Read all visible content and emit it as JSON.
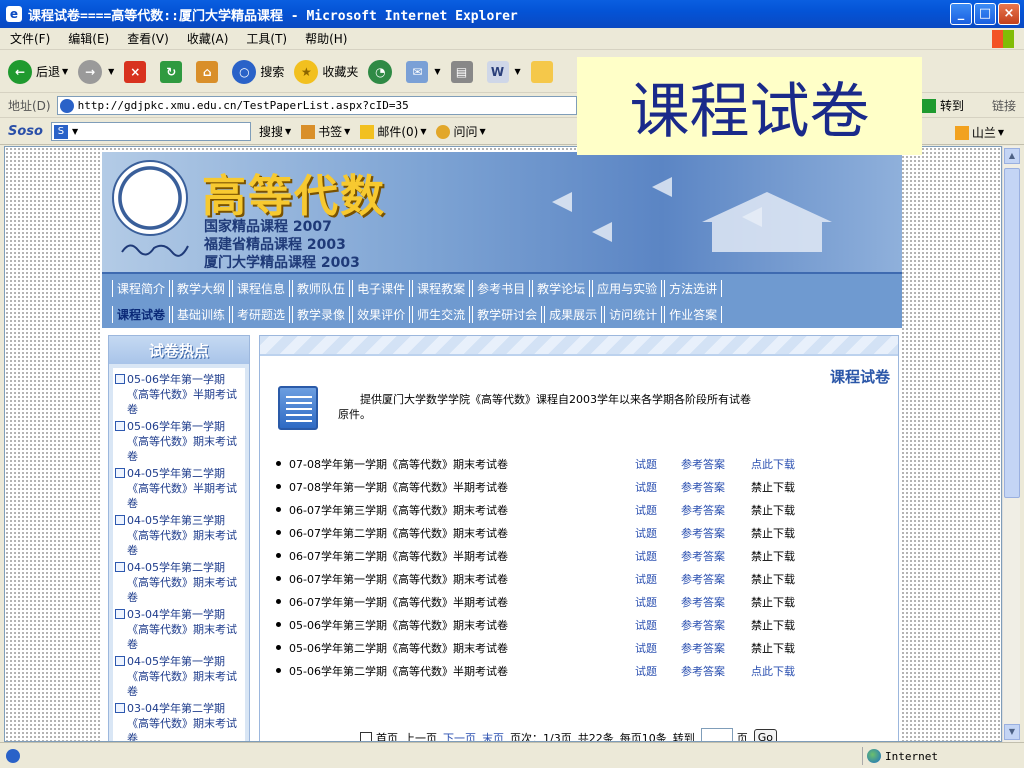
{
  "window": {
    "title": "课程试卷====高等代数::厦门大学精品课程 - Microsoft Internet Explorer",
    "minimize_icon": "minimize-icon",
    "maximize_icon": "maximize-icon",
    "close_icon": "close-icon"
  },
  "menubar": {
    "items": [
      "文件(F)",
      "编辑(E)",
      "查看(V)",
      "收藏(A)",
      "工具(T)",
      "帮助(H)"
    ]
  },
  "toolbar": {
    "back": "后退",
    "search": "搜索",
    "favorites": "收藏夹"
  },
  "addressbar": {
    "label": "地址(D)",
    "url": "http://gdjpkc.xmu.edu.cn/TestPaperList.aspx?cID=35",
    "go": "转到",
    "links": "链接"
  },
  "soso": {
    "logo": "Soso",
    "search_btn": "搜搜",
    "bookmarks": "书签",
    "mail": "邮件(0)",
    "ask": "问问",
    "right_item": "山兰"
  },
  "overlay": {
    "text": "课程试卷"
  },
  "banner": {
    "title": "高等代数",
    "line1": "国家精品课程 2007",
    "line2": "福建省精品课程 2003",
    "line3": "厦门大学精品课程 2003"
  },
  "nav": {
    "row1": [
      "课程简介",
      "教学大纲",
      "课程信息",
      "教师队伍",
      "电子课件",
      "课程教案",
      "参考书目",
      "教学论坛",
      "应用与实验",
      "方法选讲"
    ],
    "row2": [
      "课程试卷",
      "基础训练",
      "考研题选",
      "教学录像",
      "效果评价",
      "师生交流",
      "教学研讨会",
      "成果展示",
      "访问统计",
      "作业答案"
    ]
  },
  "sidebar": {
    "title": "试卷热点",
    "items": [
      "05-06学年第一学期《高等代数》半期考试卷",
      "05-06学年第一学期《高等代数》期末考试卷",
      "04-05学年第二学期《高等代数》半期考试卷",
      "04-05学年第三学期《高等代数》期末考试卷",
      "04-05学年第二学期《高等代数》期末考试卷",
      "03-04学年第一学期《高等代数》期末考试卷",
      "04-05学年第一学期《高等代数》期末考试卷",
      "03-04学年第二学期《高等代数》期末考试卷"
    ]
  },
  "main": {
    "title": "课程试卷",
    "intro": "提供厦门大学数学学院《高等代数》课程自2003学年以来各学期各阶段所有试卷原件。",
    "rows": [
      {
        "name": "07-08学年第一学期《高等代数》期末考试卷",
        "q": "试题",
        "ans": "参考答案",
        "dl": "点此下载",
        "dl_ok": true
      },
      {
        "name": "07-08学年第一学期《高等代数》半期考试卷",
        "q": "试题",
        "ans": "参考答案",
        "dl": "禁止下载",
        "dl_ok": false
      },
      {
        "name": "06-07学年第三学期《高等代数》期末考试卷",
        "q": "试题",
        "ans": "参考答案",
        "dl": "禁止下载",
        "dl_ok": false
      },
      {
        "name": "06-07学年第二学期《高等代数》期末考试卷",
        "q": "试题",
        "ans": "参考答案",
        "dl": "禁止下载",
        "dl_ok": false
      },
      {
        "name": "06-07学年第二学期《高等代数》半期考试卷",
        "q": "试题",
        "ans": "参考答案",
        "dl": "禁止下载",
        "dl_ok": false
      },
      {
        "name": "06-07学年第一学期《高等代数》期末考试卷",
        "q": "试题",
        "ans": "参考答案",
        "dl": "禁止下载",
        "dl_ok": false
      },
      {
        "name": "06-07学年第一学期《高等代数》半期考试卷",
        "q": "试题",
        "ans": "参考答案",
        "dl": "禁止下载",
        "dl_ok": false
      },
      {
        "name": "05-06学年第三学期《高等代数》期末考试卷",
        "q": "试题",
        "ans": "参考答案",
        "dl": "禁止下载",
        "dl_ok": false
      },
      {
        "name": "05-06学年第二学期《高等代数》期末考试卷",
        "q": "试题",
        "ans": "参考答案",
        "dl": "禁止下载",
        "dl_ok": false
      },
      {
        "name": "05-06学年第二学期《高等代数》半期考试卷",
        "q": "试题",
        "ans": "参考答案",
        "dl": "点此下载",
        "dl_ok": true
      }
    ]
  },
  "pager": {
    "first": "首页",
    "prev": "上一页",
    "next": "下一页",
    "last": "末页",
    "page_info": "页次：1/3页",
    "total": "共22条",
    "per_page": "每页10条",
    "goto": "转到",
    "page_unit": "页",
    "go": "Go"
  },
  "statusbar": {
    "zone": "Internet"
  },
  "colors": {
    "link_blue": "#2a4fb0",
    "banner_gold": "#f7c930",
    "nav_blue": "#6f9ad0"
  }
}
